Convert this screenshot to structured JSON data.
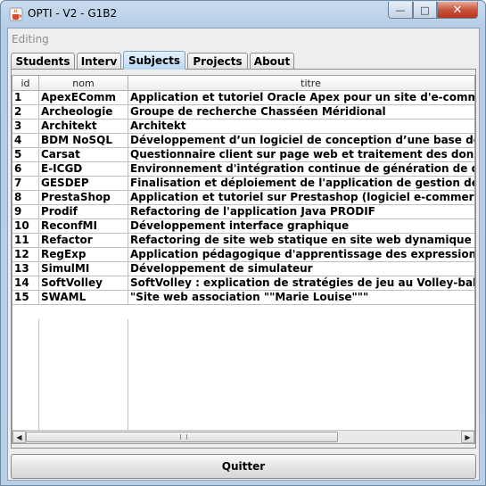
{
  "window": {
    "title": "OPTI - V2 - G1B2",
    "controls": {
      "minimize": "—",
      "maximize": "□",
      "close": "✕"
    }
  },
  "section_label": "Editing",
  "tabs": [
    {
      "label": "Students",
      "active": false
    },
    {
      "label": "Interv",
      "active": false
    },
    {
      "label": "Subjects",
      "active": true
    },
    {
      "label": "Projects",
      "active": false
    },
    {
      "label": "About",
      "active": false
    }
  ],
  "table": {
    "columns": [
      "id",
      "nom",
      "titre"
    ],
    "rows": [
      [
        "1",
        "ApexEComm",
        "Application et tutoriel Oracle Apex pour un site d'e-commerce"
      ],
      [
        "2",
        "Archeologie",
        "Groupe de recherche Chasséen Méridional"
      ],
      [
        "3",
        "Architekt",
        "Architekt"
      ],
      [
        "4",
        "BDM NoSQL",
        "Développement d’un logiciel de conception d’une base de donne"
      ],
      [
        "5",
        "Carsat",
        "Questionnaire client sur page web et traitement des données"
      ],
      [
        "6",
        "E-ICGD",
        "Environnement d'intégration continue de génération de docume"
      ],
      [
        "7",
        "GESDEP",
        "Finalisation et déploiement de l'application de gestion des dépla"
      ],
      [
        "8",
        "PrestaShop",
        "Application et tutoriel sur Prestashop (logiciel e-commerce grat"
      ],
      [
        "9",
        "Prodif",
        "Refactoring de l'application Java PRODIF"
      ],
      [
        "10",
        "ReconfMI",
        "Développement interface graphique"
      ],
      [
        "11",
        "Refactor",
        "Refactoring de site web statique en site web dynamique"
      ],
      [
        "12",
        "RegExp",
        "Application pédagogique d'apprentissage des expressions régul"
      ],
      [
        "13",
        "SimulMI",
        "Développement de simulateur"
      ],
      [
        "14",
        "SoftVolley",
        "SoftVolley : explication de stratégies de jeu au Volley-ball"
      ],
      [
        "15",
        "SWAML",
        "\"Site web association \"\"Marie Louise\"\"\""
      ]
    ]
  },
  "quit_button": "Quitter",
  "colors": {
    "active_tab": "#b9d6f1",
    "title_bar": "#c9dcef",
    "close_button": "#c8543c"
  }
}
